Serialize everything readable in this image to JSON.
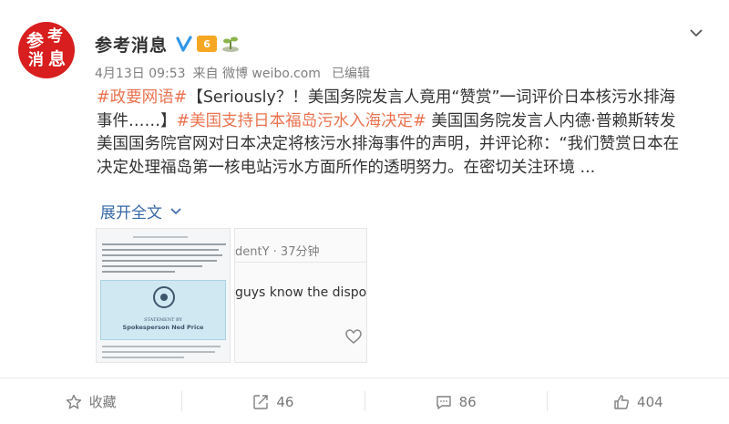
{
  "post": {
    "author": "参考消息",
    "level": "6",
    "meta": {
      "date": "4月13日 09:53",
      "source": "来自 微博 weibo.com",
      "edited": "已编辑"
    },
    "content": {
      "tag1": "#政要网语#",
      "text1": "【Seriously？！美国务院发言人竟用“赞赏”一词评价日本核污水排海事件……】",
      "tag2": "#美国支持日本福岛污水入海决定#",
      "text2": " 美国国务院发言人内德·普赖斯转发美国国务院官网对日本决定将核污水排海事件的声明，并评论称：“我们赞赏日本在决定处理福岛第一核电站污水方面所作的透明努力。在密切关注环境 ..."
    },
    "expand_label": "展开全文",
    "media": {
      "card_statement": "STATEMENT BY",
      "card_name": "Spokesperson Ned Price",
      "comment_user": "dentY · 37分钟",
      "comment_text": "guys know the disposed"
    }
  },
  "actions": {
    "favorite": "收藏",
    "repost": "46",
    "comment": "86",
    "like": "404"
  },
  "colors": {
    "accent": "#eb7350",
    "link": "#3869a8",
    "avatar": "#d81e1e",
    "level_badge": "#f6a723"
  }
}
